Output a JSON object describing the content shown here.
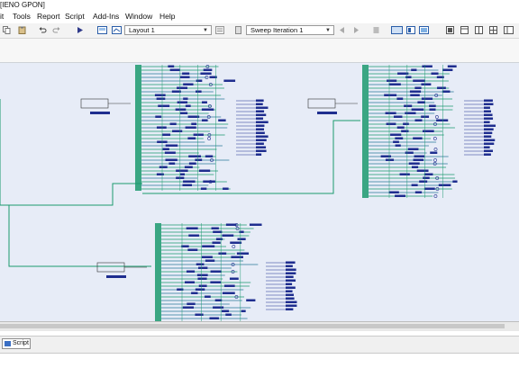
{
  "window": {
    "title_fragment": "[IENO GPON]"
  },
  "menu": [
    "it",
    "Tools",
    "Report",
    "Script",
    "Add-Ins",
    "Window",
    "Help"
  ],
  "toolbar": {
    "layout_select": "Layout 1",
    "sweep_select": "Sweep Iteration 1"
  },
  "colors": {
    "canvas_bg": "#e7ecf7",
    "wire_green": "#1b9a6e",
    "component_blue": "#1f2e8f",
    "accent": "#3a6fc4"
  },
  "bottom_tabs": {
    "script": "Script"
  }
}
